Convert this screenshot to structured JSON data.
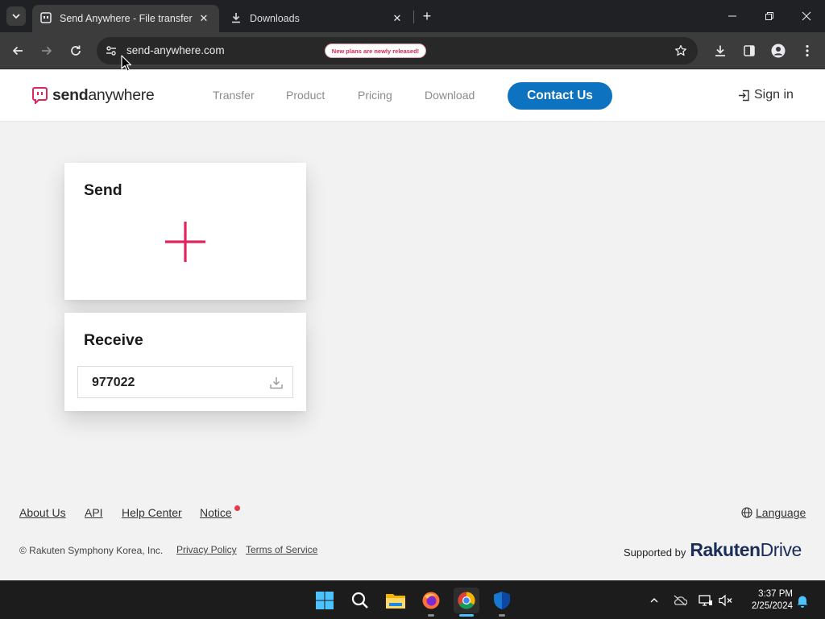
{
  "browser": {
    "tabs": [
      {
        "title": "Send Anywhere - File transfer",
        "active": true
      },
      {
        "title": "Downloads",
        "active": false
      }
    ],
    "url": "send-anywhere.com"
  },
  "header": {
    "logo_bold": "send",
    "logo_rest": "anywhere",
    "nav": [
      "Transfer",
      "Product",
      "Pricing",
      "Download"
    ],
    "contact_label": "Contact Us",
    "pricing_badge": "New plans are newly released!",
    "signin_label": "Sign in"
  },
  "send_card": {
    "title": "Send"
  },
  "receive_card": {
    "title": "Receive",
    "key_value": "977022"
  },
  "footer": {
    "links": [
      "About Us",
      "API",
      "Help Center",
      "Notice"
    ],
    "language_label": "Language",
    "copyright": "© Rakuten Symphony Korea, Inc.",
    "privacy": "Privacy Policy",
    "terms": "Terms of Service",
    "supported_by": "Supported by",
    "brand_bold": "Rakuten",
    "brand_rest": "Drive"
  },
  "taskbar": {
    "time": "3:37 PM",
    "date": "2/25/2024",
    "apps": [
      "start-icon",
      "search-icon",
      "file-explorer-icon",
      "firefox-icon",
      "chrome-icon",
      "defender-icon"
    ]
  },
  "colors": {
    "accent_blue": "#0d73c0",
    "accent_pink": "#e0245e",
    "chrome_dark": "#202124"
  }
}
